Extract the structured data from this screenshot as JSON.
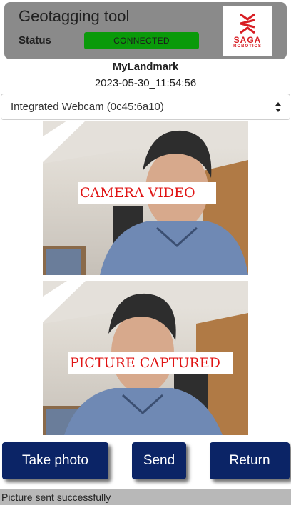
{
  "header": {
    "title": "Geotagging tool",
    "status_label": "Status",
    "status_value": "CONNECTED",
    "status_color": "#0a9a0a",
    "logo": {
      "brand": "SAGA",
      "sub": "ROBOTICS",
      "color": "#d81d23"
    }
  },
  "landmark": {
    "name": "MyLandmark",
    "timestamp": "2023-05-30_11:54:56"
  },
  "camera": {
    "selected": "Integrated Webcam (0c45:6a10)"
  },
  "video": {
    "label": "CAMERA VIDEO"
  },
  "photo": {
    "label": "PICTURE CAPTURED"
  },
  "buttons": {
    "take_photo": "Take photo",
    "send": "Send",
    "return": "Return",
    "color": "#0b2466"
  },
  "status_bar": {
    "message": "Picture sent successfully"
  }
}
